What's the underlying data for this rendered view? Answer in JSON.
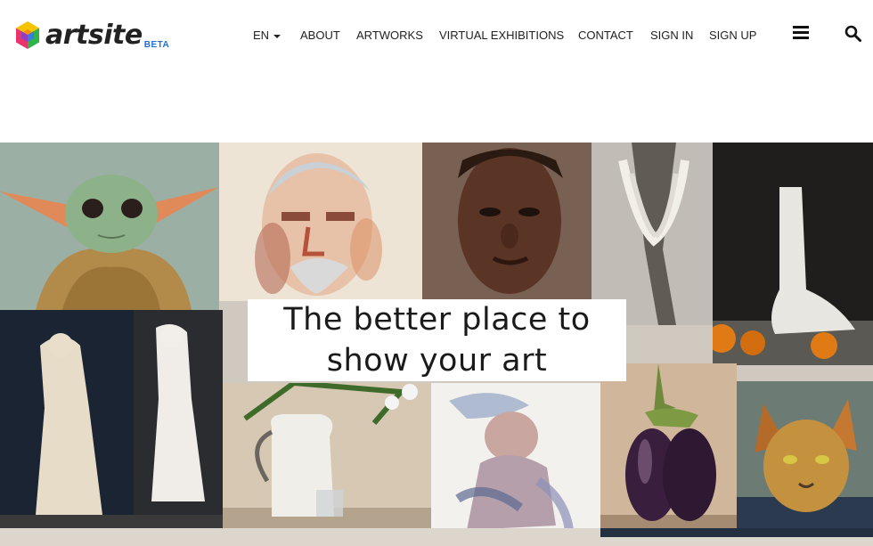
{
  "brand": {
    "name": "artsite",
    "badge": "BETA"
  },
  "nav": {
    "language": "EN",
    "items": [
      {
        "id": "about",
        "label": "ABOUT"
      },
      {
        "id": "artworks",
        "label": "ARTWORKS"
      },
      {
        "id": "virtual-exhibitions",
        "label": "VIRTUAL EXHIBITIONS"
      },
      {
        "id": "contact",
        "label": "CONTACT"
      },
      {
        "id": "sign-in",
        "label": "SIGN IN"
      },
      {
        "id": "sign-up",
        "label": "SIGN UP"
      }
    ],
    "icons": [
      "menu-icon",
      "search-icon"
    ]
  },
  "hero": {
    "tagline_line1": "The better place to",
    "tagline_line2": "show your art",
    "artworks": [
      "yoda-painting",
      "man-portrait-watercolor",
      "woman-portrait",
      "hands-drawing",
      "foot-sculpture-still-life",
      "hercules-and-venus-sculptures",
      "jug-with-flowers",
      "cherub-watercolor",
      "eggplant-painting",
      "cat-portrait"
    ]
  },
  "colors": {
    "brand_blue": "#1e6fd9",
    "text": "#222222",
    "background": "#ffffff"
  }
}
